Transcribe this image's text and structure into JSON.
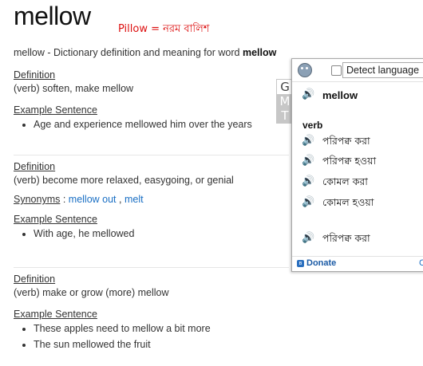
{
  "header": {
    "word": "mellow",
    "annotation": "Pillow = নরম বালিশ",
    "intro_prefix": "mellow - Dictionary definition and meaning for word ",
    "intro_word": "mellow"
  },
  "definitions": [
    {
      "heading": "Definition",
      "text": "(verb) soften, make mellow",
      "example_heading": "Example Sentence",
      "examples": [
        "Age and experience mellowed him over the years"
      ]
    },
    {
      "heading": "Definition",
      "text": "(verb) become more relaxed, easygoing, or genial",
      "synonyms_heading": "Synonyms",
      "synonyms_sep": " : ",
      "synonyms": [
        "mellow out",
        "melt"
      ],
      "example_heading": "Example Sentence",
      "examples": [
        "With age, he mellowed"
      ]
    },
    {
      "heading": "Definition",
      "text": "(verb) make or grow (more) mellow",
      "example_heading": "Example Sentence",
      "examples": [
        "These apples need to mellow a bit more",
        "The sun mellowed the fruit"
      ]
    }
  ],
  "gmt_tab": [
    "G",
    "M",
    "T"
  ],
  "popup": {
    "detect_label": "Detect language",
    "source_word": "mellow",
    "part_of_speech": "verb",
    "translations": [
      "পরিপক্ব করা",
      "পরিপক্ব হওয়া",
      "কোমল করা",
      "কোমল হওয়া",
      "পরিপক্ব করা"
    ],
    "donate_label": "Donate",
    "footer_right": "C"
  },
  "icons": {
    "speaker": "speaker-icon",
    "owl": "owl-icon",
    "bluetooth": "bluetooth-icon"
  }
}
